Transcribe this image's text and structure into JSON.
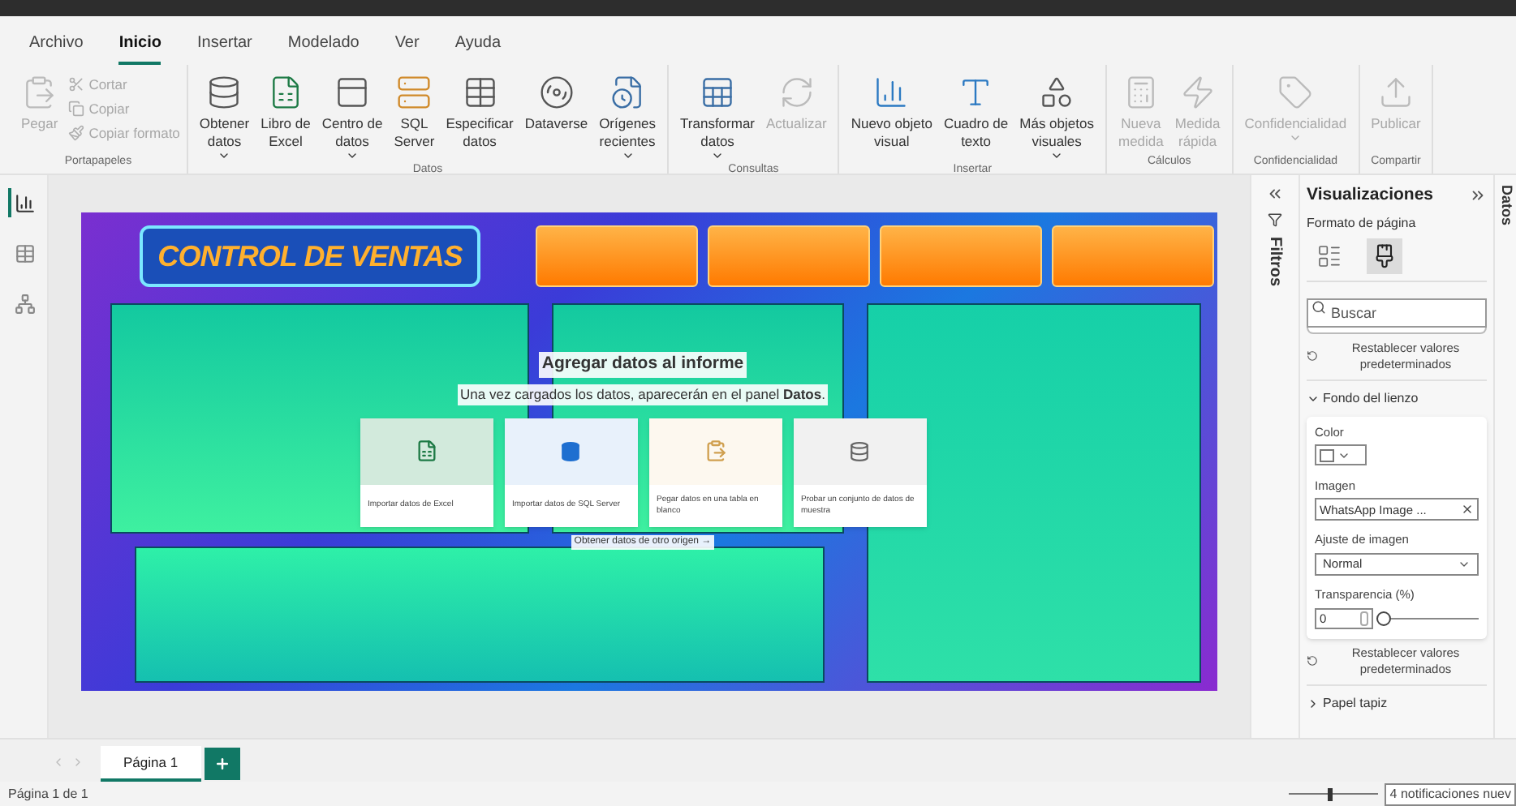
{
  "menu_tabs": [
    {
      "label": "Archivo",
      "selected": false
    },
    {
      "label": "Inicio",
      "selected": true
    },
    {
      "label": "Insertar",
      "selected": false
    },
    {
      "label": "Modelado",
      "selected": false
    },
    {
      "label": "Ver",
      "selected": false
    },
    {
      "label": "Ayuda",
      "selected": false
    }
  ],
  "ribbon_groups": [
    {
      "label": "Portapapeles",
      "buttons": [
        {
          "kind": "large",
          "label": "Pegar",
          "dropdown": false,
          "disabled": true
        },
        {
          "kind": "small",
          "label": "Cortar",
          "disabled": true
        },
        {
          "kind": "small",
          "label": "Copiar",
          "disabled": true
        },
        {
          "kind": "small",
          "label": "Copiar formato",
          "disabled": true
        }
      ]
    },
    {
      "label": "Datos",
      "buttons": [
        {
          "kind": "large",
          "label": "Obtener\ndatos",
          "dropdown": true,
          "disabled": false
        },
        {
          "kind": "large",
          "label": "Libro de\nExcel",
          "dropdown": false,
          "disabled": false
        },
        {
          "kind": "large",
          "label": "Centro de\ndatos",
          "dropdown": true,
          "disabled": false
        },
        {
          "kind": "large",
          "label": "SQL\nServer",
          "dropdown": false,
          "disabled": false
        },
        {
          "kind": "large",
          "label": "Especificar\ndatos",
          "dropdown": false,
          "disabled": false
        },
        {
          "kind": "large",
          "label": "Dataverse",
          "dropdown": false,
          "disabled": false
        },
        {
          "kind": "large",
          "label": "Orígenes\nrecientes",
          "dropdown": true,
          "disabled": false
        }
      ]
    },
    {
      "label": "Consultas",
      "buttons": [
        {
          "kind": "large",
          "label": "Transformar\ndatos",
          "dropdown": true,
          "disabled": false
        },
        {
          "kind": "large",
          "label": "Actualizar",
          "dropdown": false,
          "disabled": true
        }
      ]
    },
    {
      "label": "Insertar",
      "buttons": [
        {
          "kind": "large",
          "label": "Nuevo objeto\nvisual",
          "dropdown": false,
          "disabled": false
        },
        {
          "kind": "large",
          "label": "Cuadro de\ntexto",
          "dropdown": false,
          "disabled": false
        },
        {
          "kind": "large",
          "label": "Más objetos\nvisuales",
          "dropdown": true,
          "disabled": false
        }
      ]
    },
    {
      "label": "Cálculos",
      "buttons": [
        {
          "kind": "large",
          "label": "Nueva\nmedida",
          "dropdown": false,
          "disabled": true
        },
        {
          "kind": "large",
          "label": "Medida\nrápida",
          "dropdown": false,
          "disabled": true
        }
      ]
    },
    {
      "label": "Confidencialidad",
      "buttons": [
        {
          "kind": "large",
          "label": "Confidencialidad",
          "dropdown": true,
          "disabled": true
        }
      ]
    },
    {
      "label": "Compartir",
      "buttons": [
        {
          "kind": "large",
          "label": "Publicar",
          "dropdown": false,
          "disabled": true
        }
      ]
    }
  ],
  "rail_items": [
    {
      "kind": "report",
      "selected": true
    },
    {
      "kind": "table",
      "selected": false
    },
    {
      "kind": "model",
      "selected": false
    }
  ],
  "report_background": {
    "title": "CONTROL DE VENTAS"
  },
  "add_data": {
    "title": "Agregar datos al informe",
    "subtitle": "Una vez cargados los datos, aparecerán en el panel **Datos**.",
    "options": [
      {
        "kind": "excel",
        "label": "Importar datos de Excel"
      },
      {
        "kind": "sql",
        "label": "Importar datos de SQL Server"
      },
      {
        "kind": "paste",
        "label": "Pegar datos en una tabla en blanco"
      },
      {
        "kind": "sample",
        "label": "Probar un conjunto de datos de muestra"
      }
    ],
    "link": "Obtener datos de otro origen →"
  },
  "filters_pane": {
    "label": "Filtros"
  },
  "visualizations": {
    "title": "Visualizaciones",
    "subtitle": "Formato de página",
    "pane_tabs": [
      {
        "kind": "build",
        "selected": false
      },
      {
        "kind": "format",
        "selected": true
      }
    ],
    "search": {
      "placeholder": "Buscar"
    },
    "reset_top": "Restablecer valores predeterminados",
    "section": {
      "title": "Fondo del lienzo",
      "expanded": true,
      "color_label": "Color",
      "image_label": "Imagen",
      "image_value": "WhatsApp Image ...",
      "fit_label": "Ajuste de imagen",
      "fit_value": "Normal",
      "transparency_label": "Transparencia (%)",
      "transparency_value": "0",
      "transparency": {
        "level": 0
      }
    },
    "reset_bottom": "Restablecer valores predeterminados",
    "next_section": {
      "title": "Papel tapiz",
      "expanded": false
    }
  },
  "data_pane": {
    "label": "Datos"
  },
  "page_tabs": [
    {
      "label": "Página 1",
      "selected": true
    }
  ],
  "status_bar": {
    "page": "Página 1 de 1",
    "zoom": {
      "level": 0.45
    },
    "notification": "4 notificaciones nuev"
  }
}
